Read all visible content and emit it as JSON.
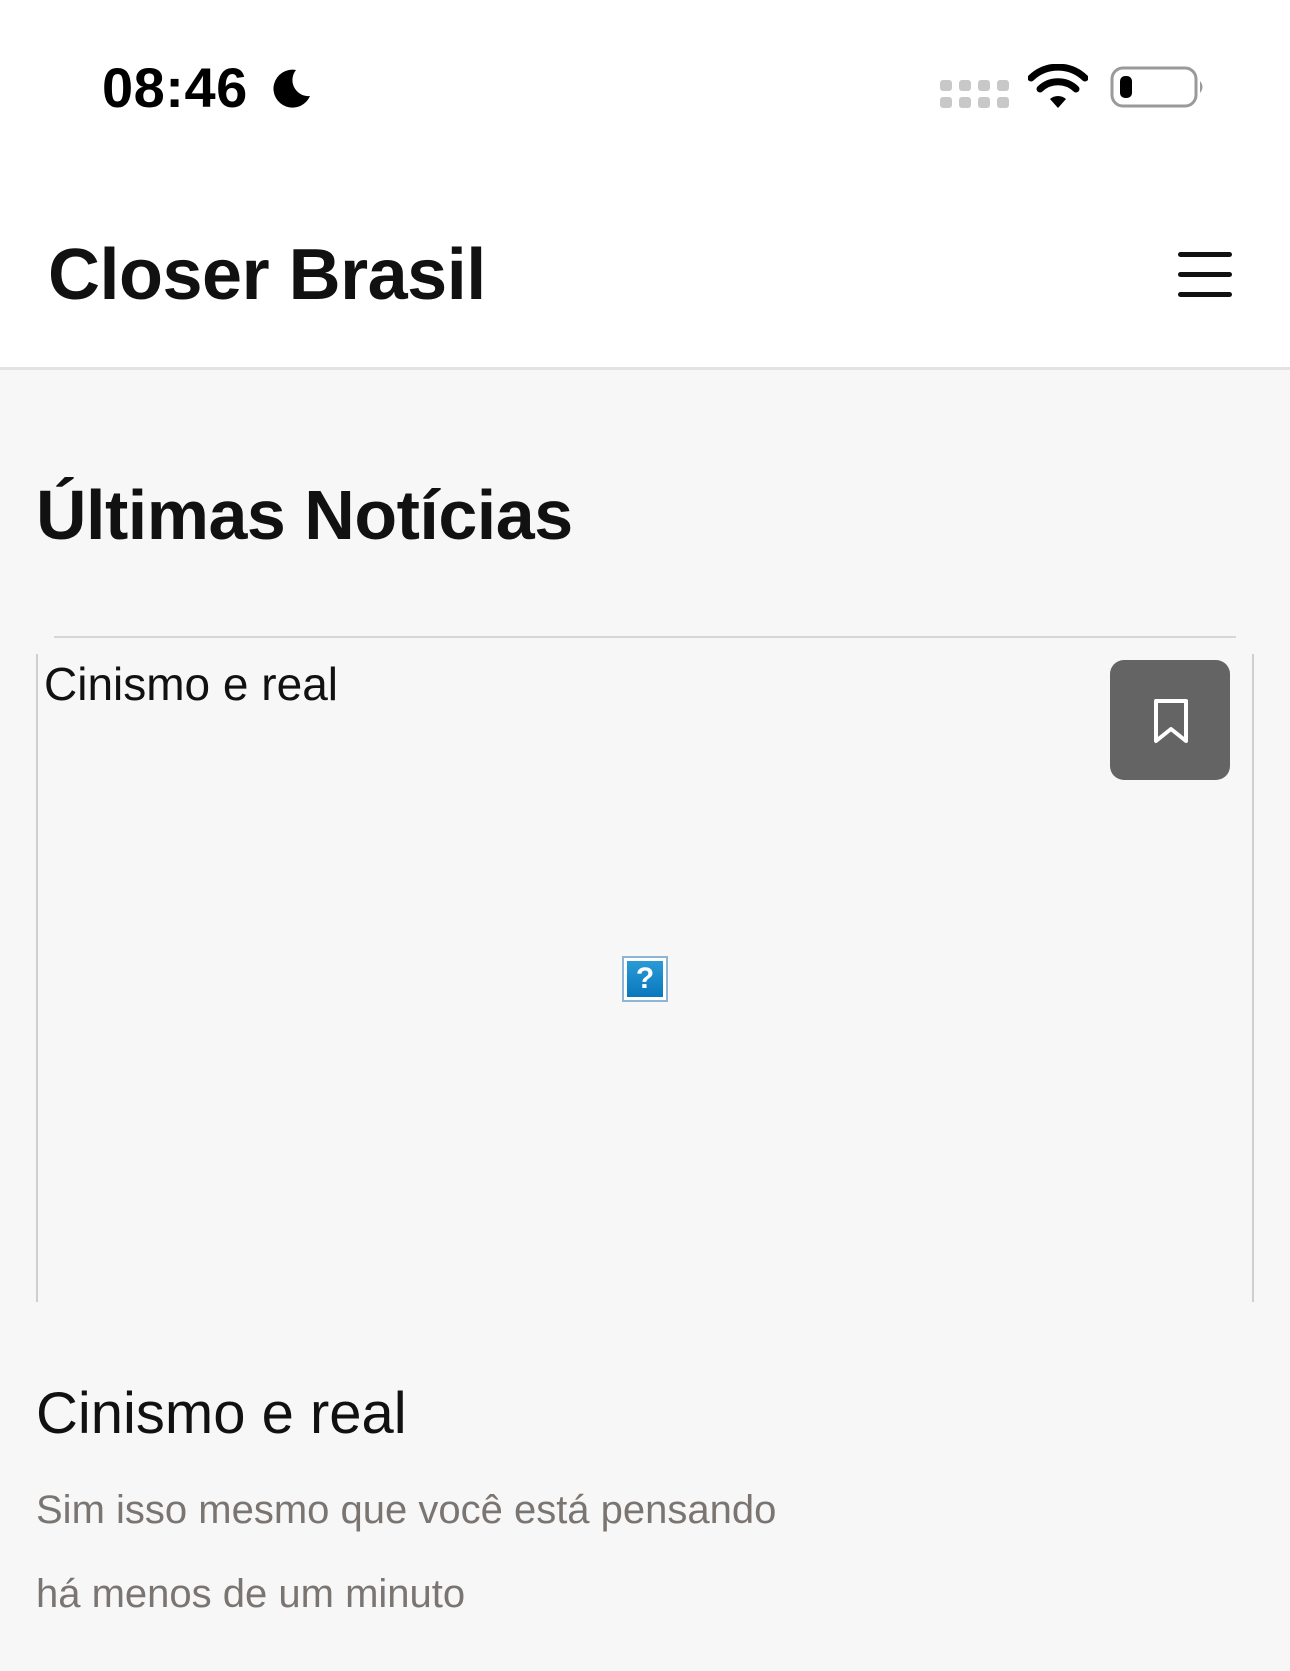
{
  "status_bar": {
    "time": "08:46",
    "icons": [
      "moon-icon",
      "cellular-signal-icon",
      "wifi-icon",
      "battery-icon"
    ]
  },
  "header": {
    "site_title": "Closer Brasil",
    "menu_icon": "hamburger-menu-icon"
  },
  "main": {
    "section_heading": "Últimas Notícias",
    "articles": [
      {
        "image_alt": "Cinismo e real",
        "title": "Cinismo e real",
        "summary": "Sim isso mesmo que você está pensando",
        "time_ago": "há menos de um minuto",
        "bookmark_icon": "bookmark-icon"
      }
    ]
  },
  "colors": {
    "page_background": "#f7f7f7",
    "header_background": "#ffffff",
    "bookmark_button": "#646464",
    "muted_text": "#7b7572"
  }
}
